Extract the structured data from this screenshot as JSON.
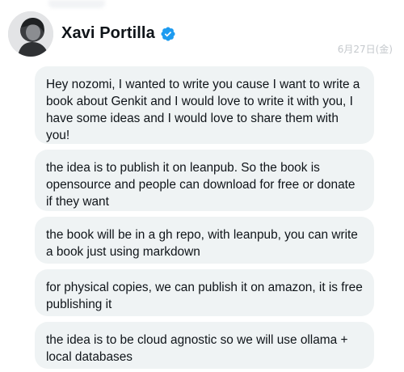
{
  "header": {
    "name": "Xavi Portilla",
    "timestamp": "6月27日(金)",
    "verified_icon": "verified-badge-icon",
    "colors": {
      "verified": "#1d9bf0",
      "bubble_bg": "#eff3f4",
      "timestamp": "#c5c9cd"
    }
  },
  "messages": [
    {
      "text": "Hey nozomi, I wanted to write you cause I want to write a book about Genkit and I would love to write it with you, I have some ideas and I would love to share them with you!"
    },
    {
      "text": "the idea is to publish it on leanpub. So the book is opensource and people can download for free or donate if they want"
    },
    {
      "text": "the book will be in a gh repo, with leanpub, you can write a book just using markdown"
    },
    {
      "text": "for physical copies, we can publish it on amazon, it is free publishing it"
    },
    {
      "text": "the idea is to be cloud agnostic so we will use ollama + local databases"
    }
  ]
}
